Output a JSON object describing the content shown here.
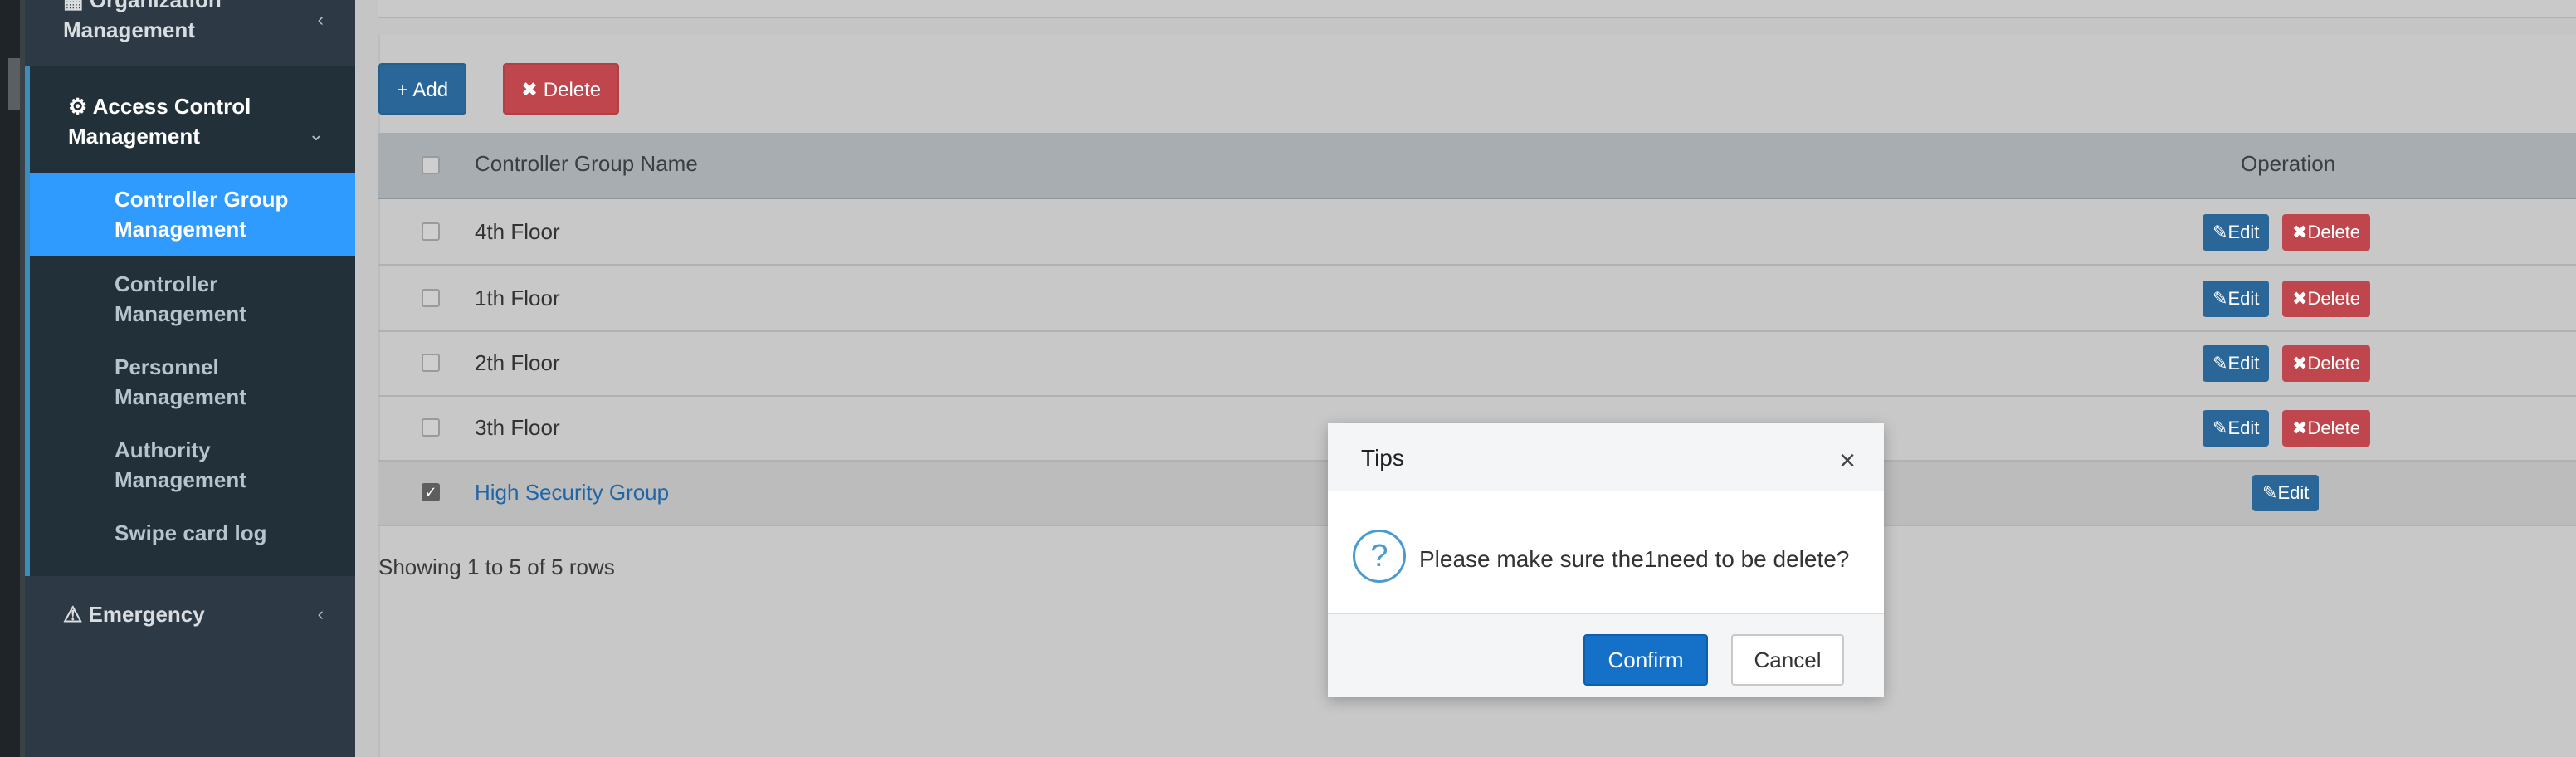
{
  "sidebar": {
    "org_label_1": "Organization",
    "org_label_2": "Management",
    "access_label_1": "Access Control",
    "access_label_2": "Management",
    "submenu": [
      {
        "line1": "Controller Group",
        "line2": "Management"
      },
      {
        "line1": "Controller",
        "line2": "Management"
      },
      {
        "line1": "Personnel",
        "line2": "Management"
      },
      {
        "line1": "Authority",
        "line2": "Management"
      },
      {
        "line1": "Swipe card log",
        "line2": ""
      }
    ],
    "emergency_label": "Emergency",
    "active_index": 0
  },
  "toolbar": {
    "add_label": "+ Add",
    "delete_label": "✖ Delete"
  },
  "table": {
    "columns": [
      "Controller Group Name",
      "Operation"
    ],
    "rows": [
      {
        "name": "4th Floor",
        "checked": false,
        "edit": "Edit",
        "delete": "Delete"
      },
      {
        "name": "1th Floor",
        "checked": false,
        "edit": "Edit",
        "delete": "Delete"
      },
      {
        "name": "2th Floor",
        "checked": false,
        "edit": "Edit",
        "delete": "Delete"
      },
      {
        "name": "3th Floor",
        "checked": false,
        "edit": "Edit",
        "delete": "Delete"
      },
      {
        "name": "High Security Group",
        "checked": true,
        "edit": "Edit",
        "delete": ""
      }
    ],
    "footer": "Showing 1 to 5 of 5 rows"
  },
  "modal": {
    "title": "Tips",
    "close": "×",
    "message": "Please make sure the1need to be delete?",
    "confirm": "Confirm",
    "cancel": "Cancel"
  },
  "colors": {
    "sidebar_bg": "#2d3a45",
    "active_item": "#2f9bff",
    "edit_button": "#2a6798",
    "delete_button": "#c0464d",
    "confirm_button": "#1570c8"
  }
}
